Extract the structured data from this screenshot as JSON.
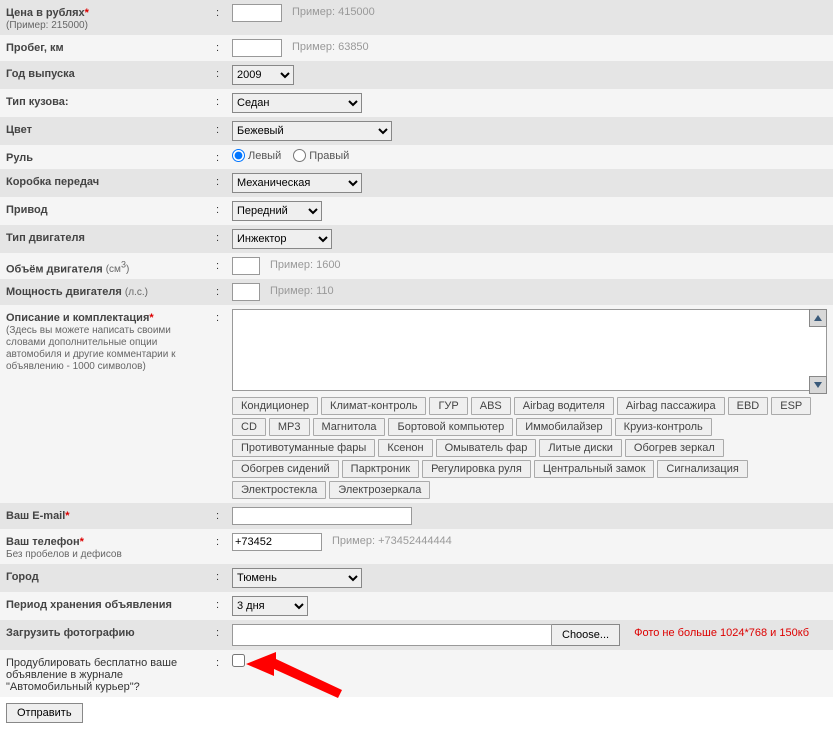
{
  "fields": {
    "price": {
      "label": "Цена в рублях",
      "sub": "(Пример: 215000)",
      "hint": "Пример: 415000"
    },
    "mileage": {
      "label": "Пробег, км",
      "hint": "Пример: 63850"
    },
    "year": {
      "label": "Год выпуска",
      "value": "2009"
    },
    "body": {
      "label": "Тип кузова:",
      "value": "Седан"
    },
    "color": {
      "label": "Цвет",
      "value": "Бежевый"
    },
    "wheel": {
      "label": "Руль",
      "left": "Левый",
      "right": "Правый"
    },
    "gearbox": {
      "label": "Коробка передач",
      "value": "Механическая"
    },
    "drive": {
      "label": "Привод",
      "value": "Передний"
    },
    "engine": {
      "label": "Тип двигателя",
      "value": "Инжектор"
    },
    "volume": {
      "label_pre": "Объём двигателя ",
      "label_unit": "(см",
      "label_post": ")",
      "hint": "Пример: 1600"
    },
    "power": {
      "label": "Мощность двигателя ",
      "label_unit": "(л.с.)",
      "hint": "Пример: 110"
    },
    "desc": {
      "label": "Описание и комплектация",
      "sub": "(Здесь вы можете написать своими словами дополнительные опции автомобиля и другие комментарии к объявлению - 1000 символов)"
    },
    "email": {
      "label": "Ваш E-mail"
    },
    "phone": {
      "label": "Ваш телефон",
      "sub": "Без пробелов и дефисов",
      "value": "+73452",
      "hint": "Пример: +73452444444"
    },
    "city": {
      "label": "Город",
      "value": "Тюмень"
    },
    "period": {
      "label": "Период хранения объявления",
      "value": "3 дня"
    },
    "photo": {
      "label": "Загрузить фотографию",
      "btn": "Choose...",
      "warn": "Фото не больше 1024*768 и 150кб"
    },
    "dup": {
      "label": "Продублировать бесплатно ваше объявление в журнале \"Автомобильный курьер\"?"
    }
  },
  "options": [
    "Кондиционер",
    "Климат-контроль",
    "ГУР",
    "ABS",
    "Airbag водителя",
    "Airbag пассажира",
    "EBD",
    "ESP",
    "CD",
    "MP3",
    "Магнитола",
    "Бортовой компьютер",
    "Иммобилайзер",
    "Круиз-контроль",
    "Противотуманные фары",
    "Ксенон",
    "Омыватель фар",
    "Литые диски",
    "Обогрев зеркал",
    "Обогрев сидений",
    "Парктроник",
    "Регулировка руля",
    "Центральный замок",
    "Сигнализация",
    "Электростекла",
    "Электрозеркала"
  ],
  "submit": "Отправить"
}
